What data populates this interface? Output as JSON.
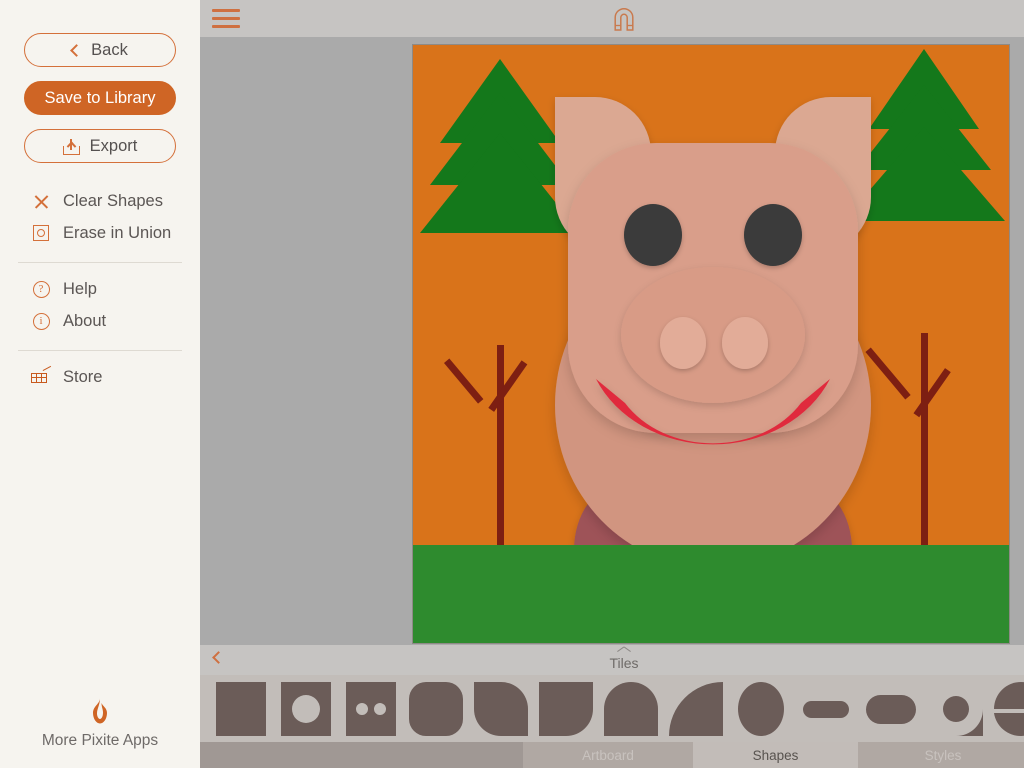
{
  "sidebar": {
    "buttons": [
      {
        "id": "back",
        "label": "Back",
        "icon": "chevron-left-icon",
        "style": "outline"
      },
      {
        "id": "save",
        "label": "Save to Library",
        "icon": "none",
        "style": "filled"
      },
      {
        "id": "export",
        "label": "Export",
        "icon": "upload-icon",
        "style": "outline"
      }
    ],
    "menu_group_1": [
      {
        "id": "clear-shapes",
        "label": "Clear Shapes",
        "icon": "x-icon"
      },
      {
        "id": "erase-in-union",
        "label": "Erase in Union",
        "icon": "square-circle-icon"
      }
    ],
    "menu_group_2": [
      {
        "id": "help",
        "label": "Help",
        "icon": "question-circle-icon",
        "glyph": "?"
      },
      {
        "id": "about",
        "label": "About",
        "icon": "info-circle-icon",
        "glyph": "i"
      }
    ],
    "menu_group_3": [
      {
        "id": "store",
        "label": "Store",
        "icon": "cart-icon"
      }
    ],
    "footer": {
      "label": "More Pixite Apps",
      "icon": "pixite-flame-logo"
    }
  },
  "topbar": {
    "menu_icon": "hamburger-icon",
    "magnet_icon": "magnet-icon"
  },
  "bottom_panel": {
    "back_icon": "chevron-left-icon",
    "caret_icon": "chevron-up-icon",
    "title": "Tiles",
    "shapes": [
      {
        "id": "square",
        "name": "square-shape"
      },
      {
        "id": "square-hole",
        "name": "square-with-circle-hole-shape"
      },
      {
        "id": "square-two-dots",
        "name": "square-with-two-dots-shape"
      },
      {
        "id": "rounded-square",
        "name": "rounded-square-shape"
      },
      {
        "id": "rounded-bottom",
        "name": "rounded-bottom-shape"
      },
      {
        "id": "leaf-right",
        "name": "leaf-shape"
      },
      {
        "id": "arch",
        "name": "arch-shape"
      },
      {
        "id": "quarter-circle",
        "name": "quarter-circle-shape"
      },
      {
        "id": "ellipse",
        "name": "ellipse-shape"
      },
      {
        "id": "pill-small",
        "name": "small-pill-shape"
      },
      {
        "id": "pill-wide",
        "name": "wide-pill-shape"
      },
      {
        "id": "ring-teardrop",
        "name": "ring-teardrop-shape"
      },
      {
        "id": "split-circle",
        "name": "split-circle-shape"
      }
    ],
    "tabs": [
      {
        "id": "blank-left",
        "label": "",
        "selected": false
      },
      {
        "id": "artboard",
        "label": "Artboard",
        "selected": false
      },
      {
        "id": "shapes",
        "label": "Shapes",
        "selected": true
      },
      {
        "id": "styles",
        "label": "Styles",
        "selected": false
      },
      {
        "id": "blank-right",
        "label": "",
        "selected": false
      }
    ]
  },
  "artwork": {
    "name": "pig-in-forest-illustration",
    "colors": {
      "background": "#d9731a",
      "grass": "#2e8b2e",
      "pig_body": "#d49a85",
      "pig_head": "#d99e8a",
      "pig_snout": "#d89b86",
      "pig_nostril": "#e0aa96",
      "pig_eye": "#3a3a3a",
      "pig_mouth": "#e02b3c",
      "pig_leg": "#9e5358",
      "tree_foliage": "#14781b",
      "tree_trunk": "#7d1f12"
    }
  },
  "theme": {
    "accent": "#cf6525",
    "accent_light": "#d4703a",
    "sidebar_bg": "#f6f4ef",
    "canvas_bg": "#aaaaaa",
    "toolbar_bg": "#c6c4c2",
    "strip_bg": "#c2bdb9",
    "text": "#5b5654"
  }
}
